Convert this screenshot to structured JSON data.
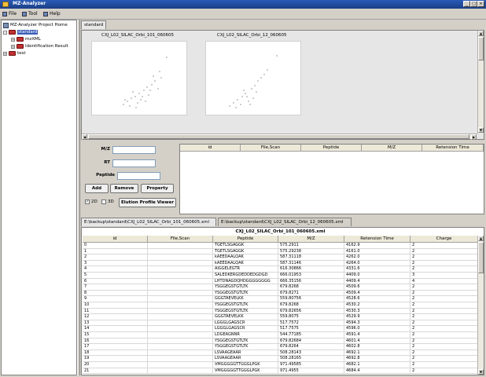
{
  "window": {
    "title": "MZ-Analyzer"
  },
  "menu": {
    "items": [
      {
        "label": "File"
      },
      {
        "label": "Tool"
      },
      {
        "label": "Help"
      }
    ]
  },
  "tree": {
    "root": "MZ-Analyzer Project Home",
    "standard": "standard",
    "mzxml": "mzXML",
    "identification": "Identification Result",
    "test": "test"
  },
  "top_tabs": [
    {
      "label": "standard"
    }
  ],
  "spectra": [
    {
      "title": "CXJ_L02_SILAC_Orbi_101_060605"
    },
    {
      "title": "CXJ_L02_SILAC_Orbi_12_060605"
    }
  ],
  "search": {
    "mz_label": "M/Z",
    "rt_label": "RT",
    "peptide_label": "Peptide",
    "add": "Add",
    "remove": "Remove",
    "property": "Property",
    "check_2d": "2D",
    "check_3d": "3D",
    "elution": "Elution Profile Viewer"
  },
  "result_columns": [
    "id",
    "File,Scan",
    "Peptide",
    "M/Z",
    "Retension Time"
  ],
  "file_tabs": [
    {
      "label": "E:\\backup\\standard\\CXJ_L02_SILAC_Orbi_101_060605.xml"
    },
    {
      "label": "E:\\backup\\standard\\CXJ_L02_SILAC_Orbi_12_060605.xml"
    }
  ],
  "data": {
    "caption": "CXJ_L02_SILAC_Orbi_101_060605.xml",
    "columns": [
      "id",
      "File,Scan",
      "Peptide",
      "M/Z",
      "Retension Time",
      "Charge"
    ],
    "rows": [
      [
        "0",
        "",
        "TGETLSGAGGK",
        "575.2911",
        "4162.9",
        "2"
      ],
      [
        "1",
        "",
        "TGETLSGAGGK",
        "575.29238",
        "4161.0",
        "2"
      ],
      [
        "2",
        "",
        "kAEEDAALQAK",
        "587.31118",
        "4262.0",
        "2"
      ],
      [
        "3",
        "",
        "kAEEDAALQAK",
        "587.31146",
        "4264.0",
        "2"
      ],
      [
        "4",
        "",
        "AIGGELEGTR",
        "616.30866",
        "4331.6",
        "2"
      ],
      [
        "5",
        "",
        "SALEDKERGDEDDEDGDGD",
        "666.01953",
        "4409.0",
        "3"
      ],
      [
        "6",
        "",
        "LHTDNAGDQHDGGGGGGGG",
        "666.35156",
        "4409.4",
        "4"
      ],
      [
        "7",
        "",
        "YSGGEGSTGTLTK",
        "679.8268",
        "4509.6",
        "2"
      ],
      [
        "8",
        "",
        "YSGGEGSTGTLTK",
        "679.8271",
        "4509.4",
        "2"
      ],
      [
        "9",
        "",
        "GGGTAEVELKK",
        "559.80756",
        "4528.6",
        "2"
      ],
      [
        "10",
        "",
        "YSGGEGSTGTLTK",
        "679.8268",
        "4530.2",
        "2"
      ],
      [
        "11",
        "",
        "YSGGEGSTGTLTK",
        "679.82656",
        "4530.3",
        "2"
      ],
      [
        "12",
        "",
        "GGGTAEVELKK",
        "559.8075",
        "4529.9",
        "2"
      ],
      [
        "13",
        "",
        "LGGGLGAGSCR",
        "517.7572",
        "4594.3",
        "2"
      ],
      [
        "14",
        "",
        "LGGGLGAGSCR",
        "517.7575",
        "4596.0",
        "2"
      ],
      [
        "15",
        "",
        "LDGEAGNNR",
        "544.77185",
        "4591.4",
        "2"
      ],
      [
        "16",
        "",
        "YSGGEGSTGTLTK",
        "679.82684",
        "4601.4",
        "2"
      ],
      [
        "17",
        "",
        "YSGGEGSTGTLTK",
        "679.8264",
        "4602.8",
        "2"
      ],
      [
        "18",
        "",
        "LSVAAGEAAR",
        "508.28143",
        "4692.1",
        "2"
      ],
      [
        "19",
        "",
        "LSVAAGEAAR",
        "508.28165",
        "4692.8",
        "2"
      ],
      [
        "20",
        "",
        "VMGGGGGTTGGGLPGK",
        "971.49585",
        "4682.1",
        "2"
      ],
      [
        "21",
        "",
        "VMGGGGGTTGGGLPGK",
        "971.4955",
        "4684.4",
        "2"
      ]
    ]
  }
}
